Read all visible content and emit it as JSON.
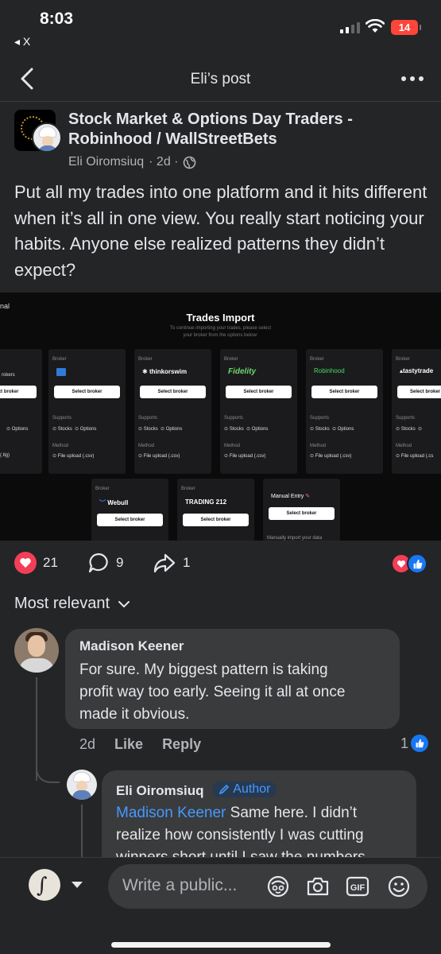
{
  "status_bar": {
    "time": "8:03",
    "back_app": "◂ X",
    "battery": "14"
  },
  "nav": {
    "title": "Eli’s post"
  },
  "post": {
    "group_name_line1": "Stock Market & Options Day Traders -",
    "group_name_line2": "Robinhood / WallStreetBets",
    "author": "Eli Oiromsiuq",
    "time": "· 2d ·",
    "text": "Put all my trades into one platform and it hits different when it’s all in one view. You really start noticing your habits. Anyone else realized patterns they didn’t expect?"
  },
  "embedded_image": {
    "corner_text": "nal",
    "title": "Trades Import",
    "subtitle_line1": "To continue importing your trades, please select",
    "subtitle_line2": "your broker from the options below:",
    "broker_label": "Broker",
    "select_label": "Select broker",
    "supports_label": "Supports",
    "method_label": "Method",
    "stocks": "Stocks",
    "options": "Options",
    "brokers": [
      {
        "name": "",
        "method": "(.tlg)"
      },
      {
        "name": "",
        "method": "File upload (.csv)"
      },
      {
        "name": "thinkorswim",
        "method": "File upload (.csv)"
      },
      {
        "name": "Fidelity",
        "method": "File upload (.csv)"
      },
      {
        "name": "Robinhood",
        "method": "File upload (.csv)"
      },
      {
        "name": "tastytrade",
        "method": "File upload (.cs"
      }
    ],
    "row2": [
      {
        "name": "Webull"
      },
      {
        "name": "TRADING 212"
      }
    ],
    "manual_title": "Manual Entry",
    "manual_desc": "Manually import your data"
  },
  "reactions": {
    "likes": "21",
    "comments": "9",
    "shares": "1"
  },
  "sort": {
    "label": "Most relevant"
  },
  "comment1": {
    "name": "Madison Keener",
    "line1": "For sure. My biggest pattern is taking",
    "line2": "profit way too early. Seeing it all at once",
    "line3": "made it obvious.",
    "time": "2d",
    "like": "Like",
    "reply": "Reply",
    "like_count": "1"
  },
  "reply1": {
    "name": "Eli Oiromsiuq",
    "badge": "Author",
    "mention": "Madison Keener",
    "line1_rest": " Same here. I didn’t",
    "line2": "realize how consistently I was cutting",
    "line3": "winners short until I saw the numbers"
  },
  "composer": {
    "placeholder": "Write a public..."
  },
  "colors": {
    "background": "#242526",
    "bubble": "#3a3b3c",
    "accent_blue": "#4599ff",
    "heart_red": "#f33e58"
  }
}
